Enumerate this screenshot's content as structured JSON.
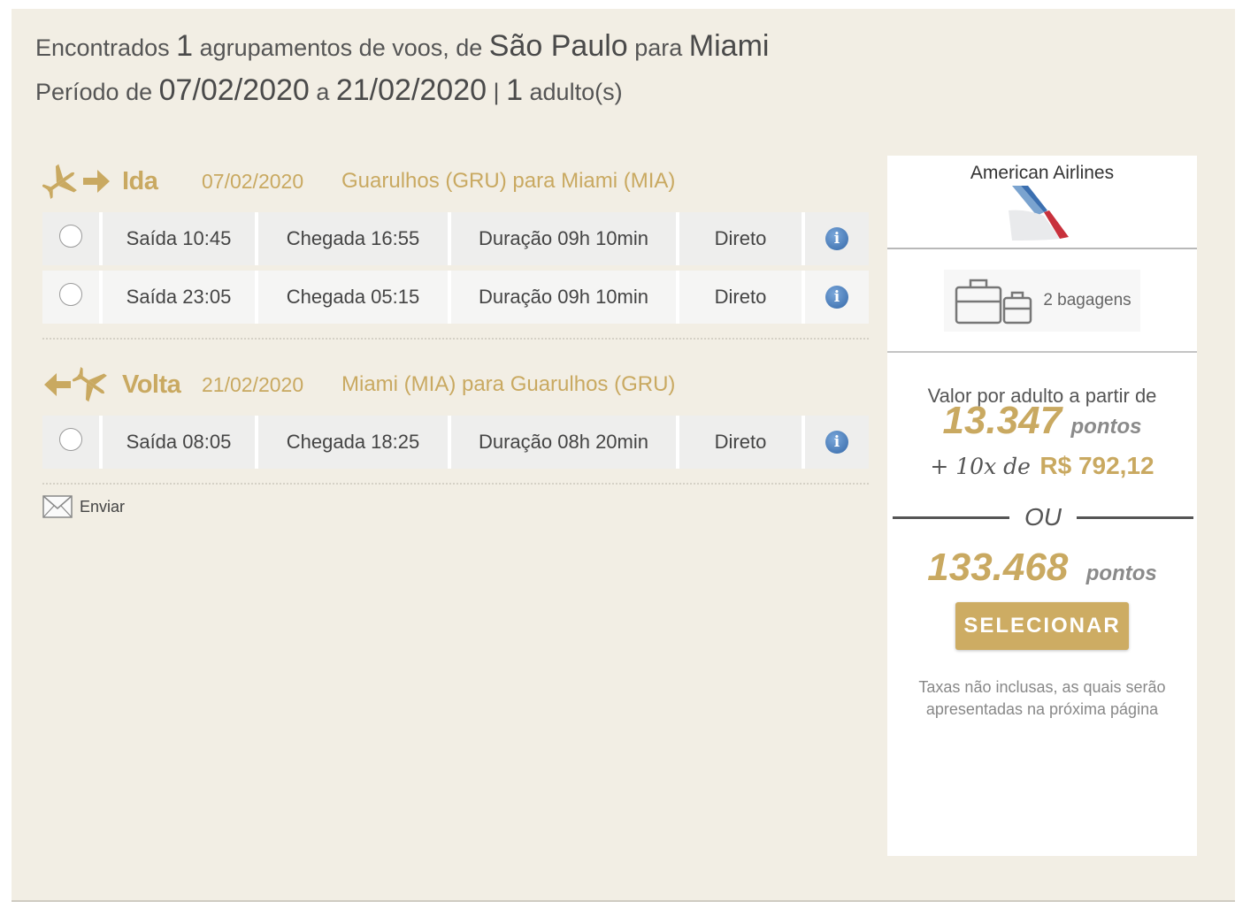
{
  "summary": {
    "found_prefix": "Encontrados",
    "groups_count": "1",
    "groups_text": "agrupamentos de voos, de",
    "origin": "São Paulo",
    "to_word": "para",
    "destination": "Miami",
    "period_prefix": "Período de",
    "start_date": "07/02/2020",
    "a_word": "a",
    "end_date": "21/02/2020",
    "separator": "|",
    "adults_count": "1",
    "adults_text": "adulto(s)"
  },
  "outbound": {
    "label": "Ida",
    "date": "07/02/2020",
    "route": "Guarulhos (GRU) para Miami (MIA)",
    "flights": [
      {
        "departure": "Saída 10:45",
        "arrival": "Chegada 16:55",
        "duration": "Duração 09h 10min",
        "stops": "Direto"
      },
      {
        "departure": "Saída 23:05",
        "arrival": "Chegada 05:15",
        "duration": "Duração 09h 10min",
        "stops": "Direto"
      }
    ]
  },
  "return": {
    "label": "Volta",
    "date": "21/02/2020",
    "route": "Miami (MIA) para Guarulhos (GRU)",
    "flights": [
      {
        "departure": "Saída 08:05",
        "arrival": "Chegada 18:25",
        "duration": "Duração 08h 20min",
        "stops": "Direto"
      }
    ]
  },
  "send_label": "Enviar",
  "offer": {
    "airline": "American Airlines",
    "baggage": "2 bagagens",
    "price_label": "Valor por adulto a partir de",
    "points_option": "13.347",
    "points_unit": "pontos",
    "installment_prefix": "+ 10x de",
    "installment_value": "R$ 792,12",
    "or_label": "OU",
    "points_full": "133.468",
    "points_full_unit": "pontos",
    "select_label": "SELECIONAR",
    "taxes_note": "Taxas não inclusas, as quais serão apresentadas na próxima página"
  },
  "colors": {
    "gold": "#c9a961",
    "panel_bg": "#f2eee4",
    "info_blue": "#3468a8"
  },
  "icons": {
    "outbound": [
      "plane-takeoff-icon",
      "arrow-right-icon"
    ],
    "return": [
      "arrow-left-icon",
      "plane-landing-icon"
    ],
    "flight_info": "info-icon",
    "send": "envelope-icon",
    "baggage": "suitcase-icon"
  }
}
